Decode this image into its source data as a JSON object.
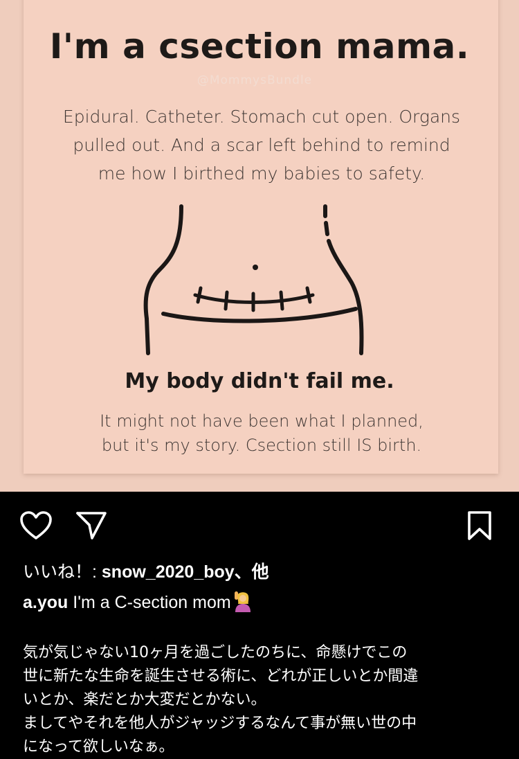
{
  "post": {
    "image": {
      "headline": "I'm a csection mama.",
      "watermark": "@MommysBundle",
      "intro_lines": [
        "Epidural. Catheter. Stomach cut open. Organs",
        "pulled out. And a scar left behind to remind",
        "me how I birthed my babies to safety."
      ],
      "subheadline": "My body didn't fail me.",
      "closing_lines": [
        "It might not have been what I planned,",
        "but it's my story. Csection still IS birth."
      ]
    },
    "actions": {
      "like_icon": "heart-outline-icon",
      "share_icon": "paper-plane-icon",
      "save_icon": "bookmark-outline-icon"
    },
    "likes": {
      "prefix": "いいね！: ",
      "users": "snow_2020_boy",
      "suffix": "、他"
    },
    "caption": {
      "username": "a.you",
      "text": " I'm a C-section mom",
      "emoji": "person-raising-hand-emoji"
    },
    "body_lines": [
      "気が気じゃない10ヶ月を過ごしたのちに、命懸けでこの",
      "世に新たな生命を誕生させる術に、どれが正しいとか間違",
      "いとか、楽だとか大変だとかない。",
      "ましてやそれを他人がジャッジするなんて事が無い世の中",
      "になって欲しいなぁ。"
    ],
    "colors": {
      "card_background": "#f5d1c1",
      "app_background": "#000000",
      "text_on_dark": "#ffffff"
    }
  }
}
